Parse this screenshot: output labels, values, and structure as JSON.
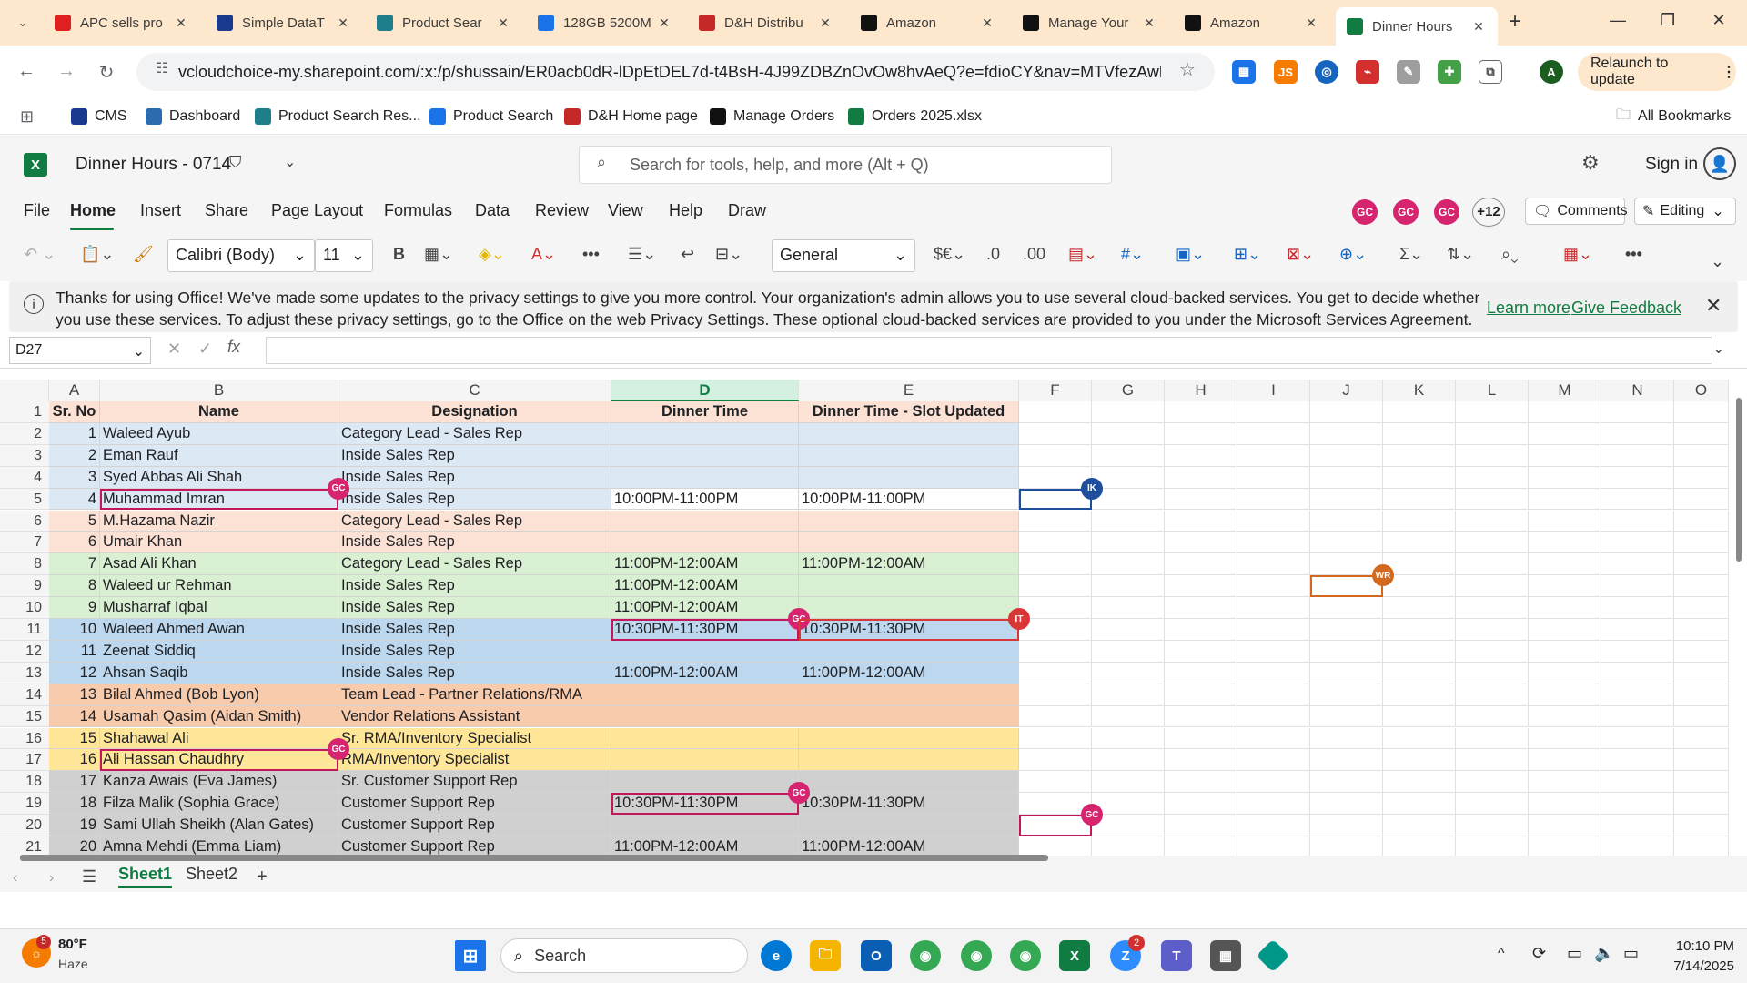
{
  "browser": {
    "tabs": [
      {
        "title": "APC sells pro",
        "favicon": "apc-icon",
        "color": "#e02020",
        "active": false
      },
      {
        "title": "Simple DataT",
        "favicon": "dh-icon",
        "color": "#1a3a8f",
        "active": false
      },
      {
        "title": "Product Sear",
        "favicon": "product-search-icon",
        "color": "#1e7e8c",
        "active": false
      },
      {
        "title": "128GB 5200M",
        "favicon": "link-icon",
        "color": "#1a73e8",
        "active": false
      },
      {
        "title": "D&H Distribu",
        "favicon": "dh-distribution-icon",
        "color": "#c62828",
        "active": false
      },
      {
        "title": "Amazon",
        "favicon": "amazon-icon",
        "color": "#111111",
        "active": false
      },
      {
        "title": "Manage Your",
        "favicon": "amazon-icon",
        "color": "#111111",
        "active": false
      },
      {
        "title": "Amazon",
        "favicon": "amazon-icon",
        "color": "#111111",
        "active": false
      },
      {
        "title": "Dinner Hours",
        "favicon": "excel-icon",
        "color": "#107c41",
        "active": true
      }
    ],
    "url": "vcloudchoice-my.sharepoint.com/:x:/p/shussain/ER0acb0dR-lDpEtDEL7d-t4BsH-4J99ZDBZnOvOw8hvAeQ?e=fdioCY&nav=MTVfezAwMDA...",
    "relaunch_label": "Relaunch to update",
    "profile_initial": "A",
    "bookmarks": [
      {
        "label": "CMS",
        "color": "#1a3a8f"
      },
      {
        "label": "Dashboard",
        "color": "#2b6cb0"
      },
      {
        "label": "Product Search Res...",
        "color": "#1e7e8c"
      },
      {
        "label": "Product Search",
        "color": "#1a73e8"
      },
      {
        "label": "D&H Home page",
        "color": "#c62828"
      },
      {
        "label": "Manage Orders",
        "color": "#111111"
      },
      {
        "label": "Orders 2025.xlsx",
        "color": "#107c41"
      }
    ],
    "all_bookmarks_label": "All Bookmarks"
  },
  "excel": {
    "doc_title": "Dinner Hours - 0714",
    "search_placeholder": "Search for tools, help, and more (Alt + Q)",
    "sign_in": "Sign in",
    "menu": [
      "File",
      "Home",
      "Insert",
      "Share",
      "Page Layout",
      "Formulas",
      "Data",
      "Review",
      "View",
      "Help",
      "Draw"
    ],
    "active_menu": "Home",
    "presence": [
      {
        "initials": "GC",
        "color": "#d6246e"
      },
      {
        "initials": "GC",
        "color": "#d6246e"
      },
      {
        "initials": "GC",
        "color": "#d6246e"
      }
    ],
    "presence_more": "+12",
    "comments_label": "Comments",
    "editing_label": "Editing",
    "ribbon": {
      "font_name": "Calibri (Body)",
      "font_size": "11",
      "number_format": "General"
    },
    "info": {
      "message": "Thanks for using Office! We've made some updates to the privacy settings to give you more control. Your organization's admin allows you to use several cloud-backed services. You get to decide whether you use these services. To adjust these privacy settings, go to the Office on the web Privacy Settings. These optional cloud-backed services are provided to you under the Microsoft Services Agreement.",
      "learn_more": "Learn more",
      "give_feedback": "Give Feedback"
    },
    "name_box": "D27",
    "columns": [
      "A",
      "B",
      "C",
      "D",
      "E",
      "F",
      "G",
      "H",
      "I",
      "J",
      "K",
      "L",
      "M",
      "N",
      "O"
    ],
    "selected_column": "D",
    "sheet": {
      "headers": [
        "Sr. No",
        "Name",
        "Designation",
        "Dinner Time",
        "Dinner Time - Slot Updated"
      ],
      "rows": [
        {
          "sr": "1",
          "name": "Waleed Ayub",
          "designation": "Category Lead - Sales Rep",
          "dinner": "",
          "updated": "",
          "fill": "#dce9f5"
        },
        {
          "sr": "2",
          "name": "Eman Rauf",
          "designation": "Inside Sales Rep",
          "dinner": "",
          "updated": "",
          "fill": "#dce9f5"
        },
        {
          "sr": "3",
          "name": "Syed Abbas Ali Shah",
          "designation": "Inside Sales Rep",
          "dinner": "",
          "updated": "",
          "fill": "#dce9f5"
        },
        {
          "sr": "4",
          "name": "Muhammad Imran",
          "designation": "Inside Sales Rep",
          "dinner": "10:00PM-11:00PM",
          "updated": "10:00PM-11:00PM",
          "fill": "#dce9f5"
        },
        {
          "sr": "5",
          "name": "M.Hazama Nazir",
          "designation": "Category Lead - Sales Rep",
          "dinner": "",
          "updated": "",
          "fill": "#fbe2d5"
        },
        {
          "sr": "6",
          "name": "Umair Khan",
          "designation": "Inside Sales Rep",
          "dinner": "",
          "updated": "",
          "fill": "#fbe2d5"
        },
        {
          "sr": "7",
          "name": "Asad Ali Khan",
          "designation": "Category Lead - Sales Rep",
          "dinner": "11:00PM-12:00AM",
          "updated": "11:00PM-12:00AM",
          "fill": "#daf0d3"
        },
        {
          "sr": "8",
          "name": "Waleed ur Rehman",
          "designation": "Inside Sales Rep",
          "dinner": "11:00PM-12:00AM",
          "updated": "",
          "fill": "#daf0d3"
        },
        {
          "sr": "9",
          "name": "Musharraf Iqbal",
          "designation": "Inside Sales Rep",
          "dinner": "11:00PM-12:00AM",
          "updated": "",
          "fill": "#daf0d3"
        },
        {
          "sr": "10",
          "name": "Waleed Ahmed Awan",
          "designation": "Inside Sales Rep",
          "dinner": "10:30PM-11:30PM",
          "updated": "10:30PM-11:30PM",
          "fill": "#bdd7ee"
        },
        {
          "sr": "11",
          "name": "Zeenat Siddiq",
          "designation": "Inside Sales Rep",
          "dinner": "",
          "updated": "",
          "fill": "#bdd7ee"
        },
        {
          "sr": "12",
          "name": "Ahsan Saqib",
          "designation": "Inside Sales Rep",
          "dinner": "11:00PM-12:00AM",
          "updated": "11:00PM-12:00AM",
          "fill": "#bdd7ee"
        },
        {
          "sr": "13",
          "name": "Bilal Ahmed (Bob Lyon)",
          "designation": "Team Lead - Partner Relations/RMA",
          "dinner": "",
          "updated": "",
          "fill": "#f8cbad"
        },
        {
          "sr": "14",
          "name": "Usamah Qasim (Aidan Smith)",
          "designation": "Vendor Relations Assistant",
          "dinner": "",
          "updated": "",
          "fill": "#f8cbad"
        },
        {
          "sr": "15",
          "name": "Shahawal Ali",
          "designation": "Sr. RMA/Inventory Specialist",
          "dinner": "",
          "updated": "",
          "fill": "#ffe699"
        },
        {
          "sr": "16",
          "name": "Ali Hassan Chaudhry",
          "designation": "RMA/Inventory Specialist",
          "dinner": "",
          "updated": "",
          "fill": "#ffe699"
        },
        {
          "sr": "17",
          "name": "Kanza Awais (Eva James)",
          "designation": "Sr. Customer Support Rep",
          "dinner": "",
          "updated": "",
          "fill": "#d0d0d0"
        },
        {
          "sr": "18",
          "name": "Filza Malik (Sophia Grace)",
          "designation": "Customer Support Rep",
          "dinner": "10:30PM-11:30PM",
          "updated": "10:30PM-11:30PM",
          "fill": "#d0d0d0"
        },
        {
          "sr": "19",
          "name": "Sami Ullah Sheikh (Alan Gates)",
          "designation": "Customer Support Rep",
          "dinner": "",
          "updated": "",
          "fill": "#d0d0d0"
        },
        {
          "sr": "20",
          "name": "Amna Mehdi (Emma Liam)",
          "designation": "Customer Support Rep",
          "dinner": "11:00PM-12:00AM",
          "updated": "11:00PM-12:00AM",
          "fill": "#d0d0d0"
        }
      ]
    },
    "cursors": [
      {
        "initials": "GC",
        "color": "#d6246e"
      },
      {
        "initials": "IK",
        "color": "#1f4e9c"
      },
      {
        "initials": "GC",
        "color": "#d6246e"
      },
      {
        "initials": "IT",
        "color": "#d93636"
      },
      {
        "initials": "WR",
        "color": "#d2691e"
      },
      {
        "initials": "GC",
        "color": "#d6246e"
      },
      {
        "initials": "GC",
        "color": "#d6246e"
      },
      {
        "initials": "GC",
        "color": "#d6246e"
      }
    ],
    "sheets": [
      "Sheet1",
      "Sheet2"
    ],
    "active_sheet": "Sheet1"
  },
  "taskbar": {
    "weather_temp": "80°F",
    "weather_desc": "Haze",
    "weather_badge": "5",
    "search_placeholder": "Search",
    "time": "10:10 PM",
    "date": "7/14/2025",
    "teams_badge": "2"
  }
}
